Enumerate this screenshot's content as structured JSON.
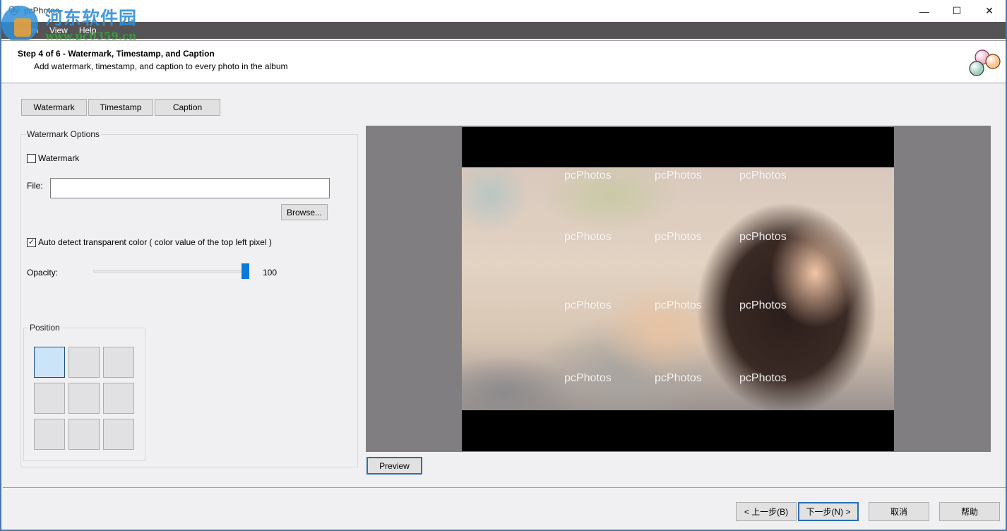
{
  "window": {
    "title": "pcPhotos",
    "controls": {
      "minimize": "—",
      "maximize": "☐",
      "close": "✕"
    }
  },
  "site_overlay": {
    "name": "河东软件园",
    "url": "www.pc0359.cn"
  },
  "menu": [
    "Album",
    "View",
    "Help"
  ],
  "header": {
    "step_title": "Step 4 of 6 - Watermark, Timestamp, and Caption",
    "step_description": "Add watermark, timestamp, and caption to every photo in the album",
    "logo_icon": "bubbles-logo-icon"
  },
  "tabs": [
    {
      "label": "Watermark",
      "active": true
    },
    {
      "label": "Timestamp",
      "active": false
    },
    {
      "label": "Caption",
      "active": false
    }
  ],
  "watermark_options": {
    "group_title": "Watermark Options",
    "watermark_checkbox": {
      "label": "Watermark",
      "checked": false
    },
    "file_label": "File:",
    "file_value": "",
    "browse_label": "Browse...",
    "auto_detect_checkbox": {
      "label": "Auto detect transparent color ( color value of the top left pixel )",
      "checked": true,
      "mark": "✓"
    },
    "opacity_label": "Opacity:",
    "opacity_value": "100",
    "opacity_fraction": 1.0,
    "position": {
      "group_title": "Position",
      "cells": [
        "top-left",
        "top-center",
        "top-right",
        "middle-left",
        "center",
        "middle-right",
        "bottom-left",
        "bottom-center",
        "bottom-right"
      ],
      "selected": "top-left"
    }
  },
  "preview": {
    "watermark_text": "pcPhotos",
    "watermark_grid": {
      "rows": 4,
      "cols": 3
    },
    "button_label": "Preview"
  },
  "footer": {
    "back_label": "< 上一步(B)",
    "next_label": "下一步(N) >",
    "cancel_label": "取消",
    "help_label": "帮助"
  },
  "colors": {
    "menubar": "#555356",
    "accent": "#0a78d7",
    "selected_cell": "#cce4f7",
    "preview_bg": "#807e81"
  }
}
